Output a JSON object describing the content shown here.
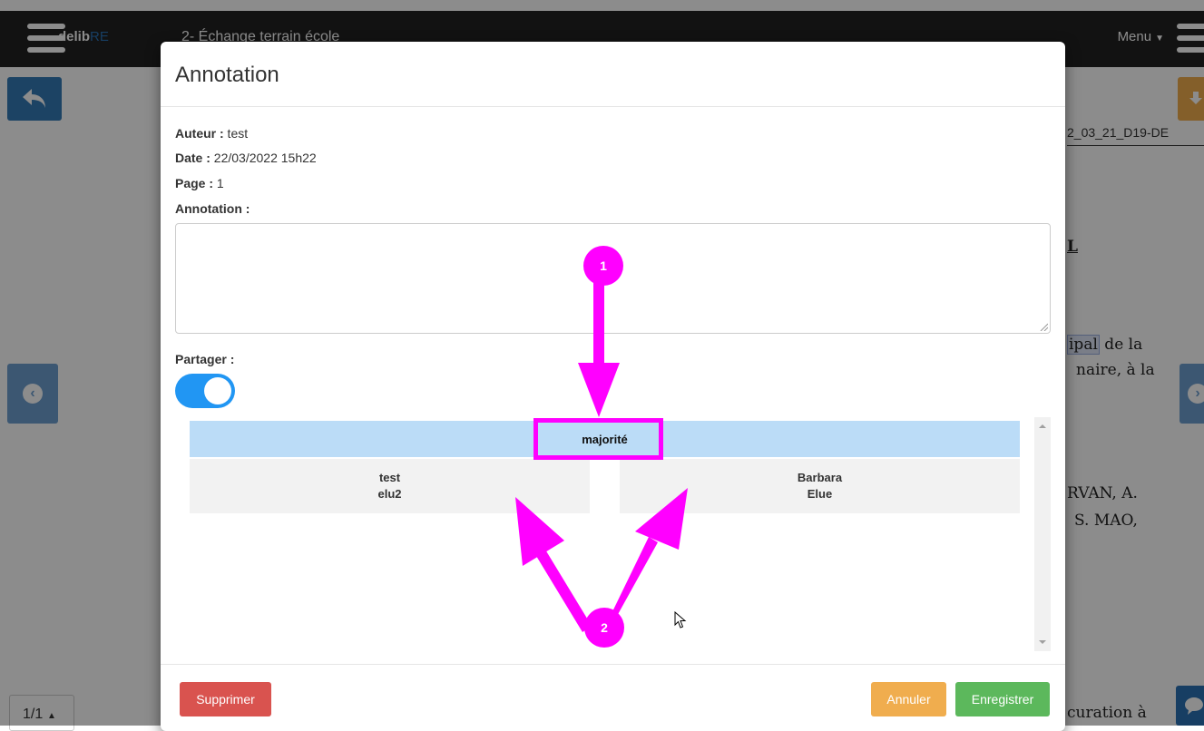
{
  "app": {
    "brand_main": "delib",
    "brand_accent": "RE",
    "document_title": "2- Échange terrain école",
    "menu_label": "Menu"
  },
  "document": {
    "reference": "2_03_21_D19-DE",
    "lines": [
      {
        "before": "",
        "highlight": "",
        "after": "L"
      },
      {
        "before": "",
        "highlight": "ipal",
        "after": " de la"
      },
      {
        "before": "",
        "highlight": "",
        "after": "naire, à la"
      },
      {
        "before": "",
        "highlight": "",
        "after": "RVAN, A."
      },
      {
        "before": "",
        "highlight": "",
        "after": "S.  MAO,"
      },
      {
        "before": "",
        "highlight": "",
        "after": "curation à"
      }
    ],
    "page_indicator": "1/1"
  },
  "modal": {
    "title": "Annotation",
    "author_label": "Auteur :",
    "author_value": " test",
    "date_label": "Date :",
    "date_value": " 22/03/2022 15h22",
    "page_label": "Page :",
    "page_value": " 1",
    "annotation_label": "Annotation :",
    "annotation_value": "",
    "share_label": "Partager :",
    "share_enabled": true,
    "group_name": "majorité",
    "members": [
      {
        "line1": "test",
        "line2": "elu2"
      },
      {
        "line1": "Barbara",
        "line2": "Elue"
      }
    ],
    "buttons": {
      "delete": "Supprimer",
      "cancel": "Annuler",
      "save": "Enregistrer"
    }
  },
  "callouts": {
    "marker1": "1",
    "marker2": "2",
    "color": "#ff00ff"
  },
  "colors": {
    "navbar": "#222222",
    "primary": "#337ab7",
    "danger": "#d9534f",
    "warning": "#f0ad4e",
    "success": "#5cb85c",
    "toggle_on": "#2196f3",
    "group_header": "#bbdcf7"
  }
}
